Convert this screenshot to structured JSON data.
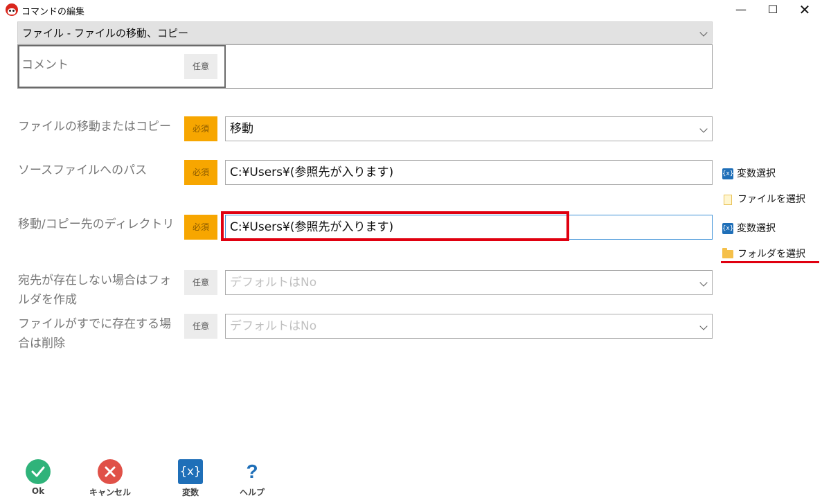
{
  "window": {
    "title": "コマンドの編集"
  },
  "command_select": {
    "value": "ファイル - ファイルの移動、コピー"
  },
  "comment": {
    "label": "コメント",
    "badge": "任意",
    "value": ""
  },
  "fields": [
    {
      "label": "ファイルの移動またはコピー",
      "badge": "必須",
      "value": "移動"
    },
    {
      "label": "ソースファイルへのパス",
      "badge": "必須",
      "value": "C:¥Users¥(参照先が入ります)"
    },
    {
      "label": "移動/コピー先のディレクトリ",
      "badge": "必須",
      "value": "C:¥Users¥(参照先が入ります)"
    },
    {
      "label": "宛先が存在しない場合はフォルダを作成",
      "badge": "任意",
      "placeholder": "デフォルトはNo"
    },
    {
      "label": "ファイルがすでに存在する場合は削除",
      "badge": "任意",
      "placeholder": "デフォルトはNo"
    }
  ],
  "side_links": {
    "var_select": "変数選択",
    "file_select": "ファイルを選択",
    "folder_select": "フォルダを選択"
  },
  "toolbar": {
    "ok": "Ok",
    "cancel": "キャンセル",
    "variables": "変数",
    "help": "ヘルプ"
  },
  "colors": {
    "required": "#f7a600",
    "highlight": "#e00010",
    "ok": "#2fb37a",
    "cancel": "#e05148",
    "variables": "#1f6fb8"
  }
}
